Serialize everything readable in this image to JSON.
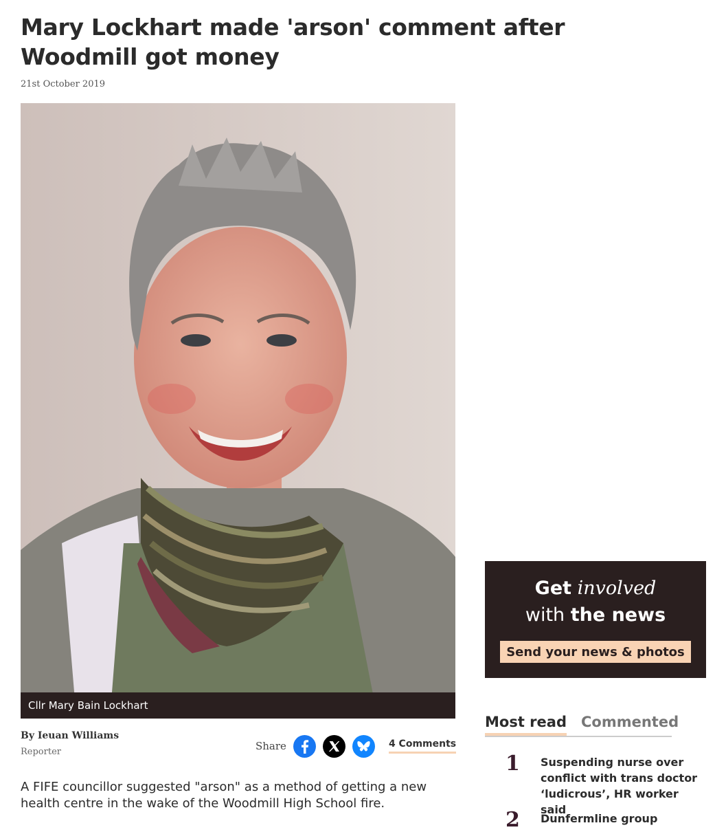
{
  "article": {
    "headline": "Mary Lockhart made 'arson' comment after Woodmill got money",
    "date": "21st October 2019",
    "image_caption": "Cllr Mary Bain Lockhart",
    "author": "By Ieuan Williams",
    "author_role": "Reporter",
    "share_label": "Share",
    "comments_link": "4 Comments",
    "lede": "A FIFE councillor suggested \"arson\" as a method of getting a new health centre in the wake of the Woodmill High School fire."
  },
  "share_icons": [
    "facebook-icon",
    "x-icon",
    "bluesky-icon"
  ],
  "colors": {
    "dark": "#2a1f1f",
    "accent": "#f9d3b4",
    "facebook": "#1877f2",
    "bluesky": "#1185fe"
  },
  "promo": {
    "get": "Get",
    "involved": "involved",
    "with": "with",
    "the_news": "the news",
    "button_label": "Send your news & photos"
  },
  "sidebar": {
    "tabs": [
      "Most read",
      "Commented"
    ],
    "most_read": [
      {
        "rank": "1",
        "title": "Suspending nurse over conflict with trans doctor ‘ludicrous’, HR worker said"
      },
      {
        "rank": "2",
        "title": "Dunfermline group"
      }
    ]
  }
}
